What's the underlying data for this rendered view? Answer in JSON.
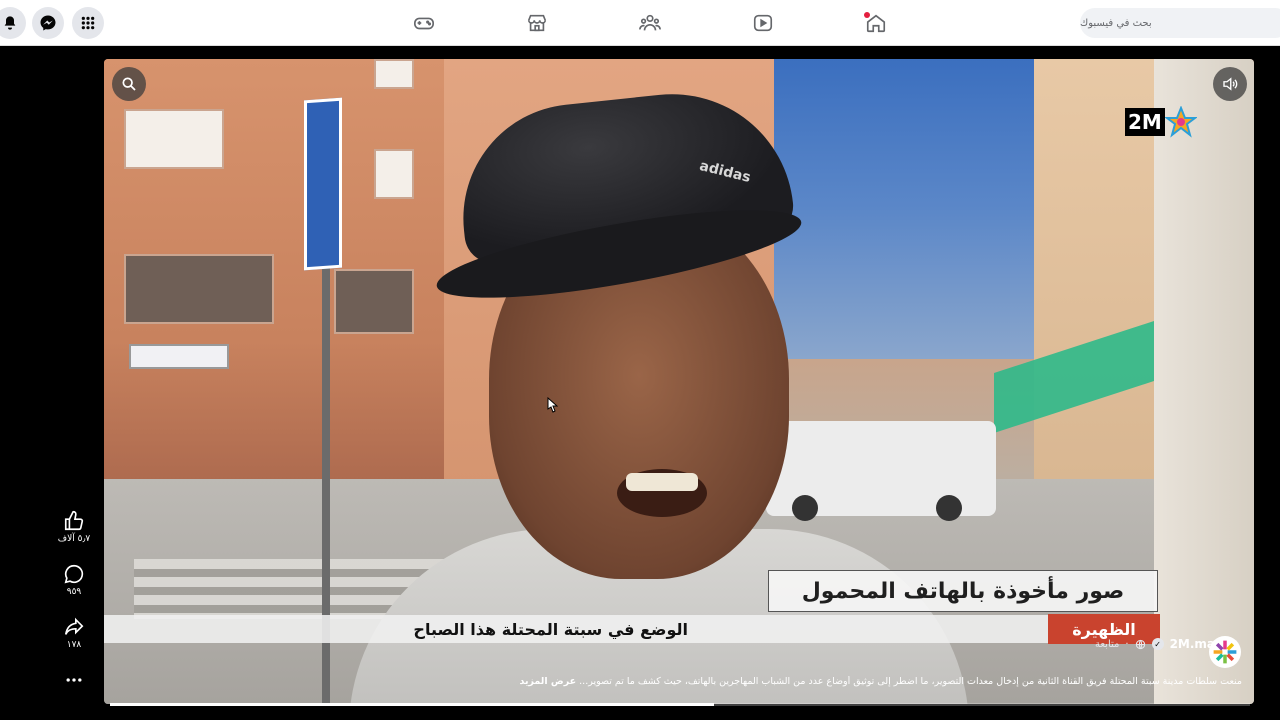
{
  "topbar": {
    "search_placeholder": "بحث في فيسبوك",
    "left_icons": [
      "notifications-icon",
      "messenger-icon",
      "menu-grid-icon"
    ],
    "nav_tabs": [
      "gaming-icon",
      "marketplace-icon",
      "groups-icon",
      "watch-icon",
      "home-icon"
    ],
    "home_notification_dot": true
  },
  "video": {
    "channel_logo_text": "2M",
    "caption": "صور مأخوذة بالهاتف المحمول",
    "ticker_text": "الوضع في سبتة المحتلة هذا الصباح",
    "ticker_tag": "الظهيرة",
    "progress": 0.53
  },
  "post": {
    "page_name": "2M.ma",
    "follow_label": "متابعة",
    "separator": "·",
    "description": "منعت سلطات مدينة سبتة المحتلة فريق القناة الثانية من إدخال معدات التصوير، ما اضطر إلى توثيق أوضاع عدد من الشباب المهاجرين بالهاتف، حيث كشف ما تم تصوير...",
    "see_more": "عرض المزيد"
  },
  "actions": {
    "likes": "٥٫٧ آلاف",
    "comments": "٩٥٩",
    "shares": "١٧٨"
  },
  "colors": {
    "accent_red": "#c9432e",
    "notification_red": "#e41e3f"
  }
}
